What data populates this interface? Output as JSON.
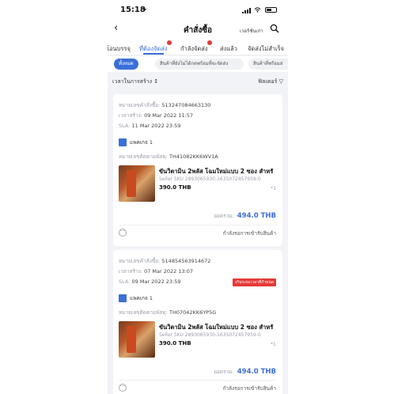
{
  "status_bar": {
    "time": "15:18",
    "location_icon": "location-arrow-icon"
  },
  "nav": {
    "back_icon": "chevron-left-icon",
    "title": "คำสั่งซื้อ",
    "old_version": "เวอร์ชั่นเก่า",
    "search_icon": "search-icon"
  },
  "tabs": [
    {
      "label": "โอนบรรจุ",
      "badge": false
    },
    {
      "label": "ที่ต้องจัดส่ง",
      "badge": true,
      "active": true
    },
    {
      "label": "กำลังจัดส่ง",
      "badge": true
    },
    {
      "label": "ส่งแล้ว",
      "badge": false
    },
    {
      "label": "จัดส่งไม่สำเร็จ",
      "badge": false
    }
  ],
  "chips": [
    "ทั้งหมด",
    "สินค้าที่ยังไม่ได้กดพร้อมที่จะจัดส่ง",
    "สินค้าที่พร้อมส"
  ],
  "sort": {
    "label": "เวลาในการสร้าง ↕",
    "filter_label": "ฟิลเตอร์"
  },
  "orders": [
    {
      "order_label": "หมายเลขคำสั่งซื้อ:",
      "order_no": "513247084663130",
      "created_label": "เวลาสร้าง:",
      "created": "09 Mar 2022 11:57",
      "sla_label": "SLA:",
      "sla": "11 Mar 2022 23:59",
      "overdue": "",
      "package": "แพคเกจ 1",
      "tracking_label": "หมายเลขติดตามพัสดุ:",
      "tracking": "TH41082KK6WV1A",
      "product_name": "ขันวิตามิน 2พลัส โฉมใหม่แบบ 2 ซอง สำหรั",
      "seller_sku": "Seller SKU 2893065930-1635072457959-0",
      "price": "390.0 THB",
      "qty": "*1",
      "total_label": "ยอดรวม:",
      "total": "494.0 THB",
      "status": "กำลังรอการเข้ารับสินค้า"
    },
    {
      "order_label": "หมายเลขคำสั่งซื้อ:",
      "order_no": "514854563914672",
      "created_label": "เวลาสร้าง:",
      "created": "07 Mar 2022 13:07",
      "sla_label": "SLA:",
      "sla": "09 Mar 2022 23:59",
      "overdue": "เกินระยะเวลาที่กำหนด",
      "package": "แพคเกจ 1",
      "tracking_label": "หมายเลขติดตามพัสดุ:",
      "tracking": "TH07042KK6YP5G",
      "product_name": "ขันวิตามิน 2พลัส โฉมใหม่แบบ 2 ซอง สำหรั",
      "seller_sku": "Seller SKU 2893065930-1635072457959-0",
      "price": "390.0 THB",
      "qty": "*1",
      "total_label": "ยอดรวม:",
      "total": "494.0 THB",
      "status": "กำลังรอการเข้ารับสินค้า"
    }
  ],
  "colors": {
    "accent": "#3b6fd8",
    "badge": "#e53935"
  }
}
